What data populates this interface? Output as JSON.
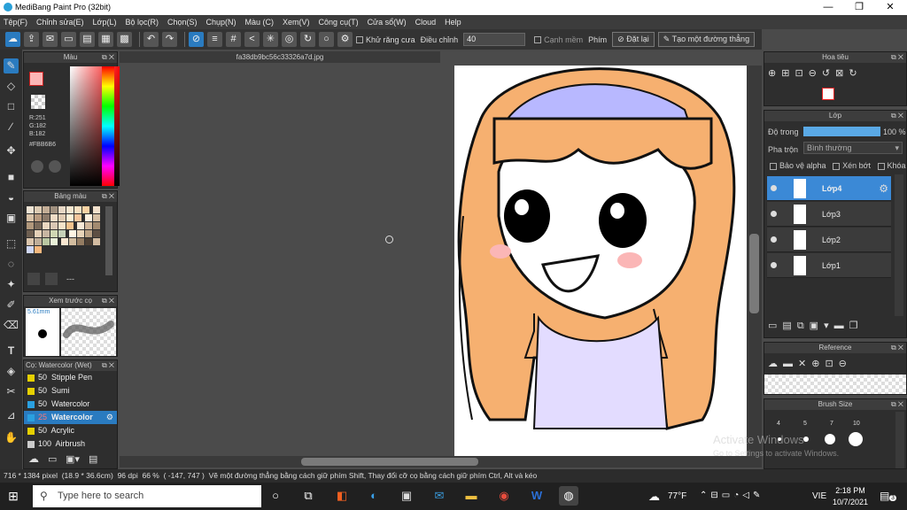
{
  "window": {
    "title": "MediBang Paint Pro (32bit)",
    "min": "—",
    "max": "❐",
    "close": "✕"
  },
  "menu": [
    "Tệp(F)",
    "Chỉnh sửa(E)",
    "Lớp(L)",
    "Bộ lọc(R)",
    "Chọn(S)",
    "Chụp(N)",
    "Màu (C)",
    "Xem(V)",
    "Công cụ(T)",
    "Cửa sổ(W)",
    "Cloud",
    "Help"
  ],
  "toolbar": {
    "antialias_label": "Khử răng cưa",
    "adjust_label": "Điều chỉnh",
    "adjust_value": "40",
    "edge_label": "Cạnh mềm",
    "key_label": "Phím",
    "reset_label": "Đặt lại",
    "create_line_label": "Tạo một đường thẳng"
  },
  "color_panel": {
    "title": "Màu",
    "r": "R:251",
    "g": "G:182",
    "b": "B:182",
    "hex": "#FBB6B6",
    "fg": "#fbb6b6"
  },
  "palette_panel": {
    "title": "Bảng màu",
    "placeholder": "---"
  },
  "brush_preview": {
    "title": "Xem trước cọ",
    "size": "5.61mm"
  },
  "brush_list": {
    "title": "Cọ: Watercolor (Wet)",
    "items": [
      {
        "size": "50",
        "name": "Stipple Pen"
      },
      {
        "size": "50",
        "name": "Sumi"
      },
      {
        "size": "50",
        "name": "Watercolor"
      },
      {
        "size": "25",
        "name": "Watercolor"
      },
      {
        "size": "50",
        "name": "Acrylic"
      },
      {
        "size": "100",
        "name": "Airbrush"
      }
    ]
  },
  "canvas": {
    "filename": "fa38db9bc56c33326a7d.jpg"
  },
  "navigator": {
    "title": "Hoa tiêu"
  },
  "layers_panel": {
    "title": "Lớp",
    "opacity_label": "Độ trong",
    "opacity_value": "100 %",
    "opacity": 1.0,
    "blend_label": "Pha trộn",
    "blend_value": "Bình thường",
    "protect_alpha": "Bảo vệ alpha",
    "clipping": "Xén bớt",
    "lock": "Khóa",
    "layers": [
      "Lớp4",
      "Lớp3",
      "Lớp2",
      "Lớp1"
    ]
  },
  "reference_panel": {
    "title": "Reference"
  },
  "brush_size_panel": {
    "title": "Brush Size",
    "sizes": [
      "4",
      "5",
      "7",
      "10"
    ]
  },
  "status": {
    "size": "716 * 1384 pixel",
    "physical": "(18.9 * 36.6cm)",
    "dpi": "96 dpi",
    "zoom": "66 %",
    "coords": "( -147, 747 )",
    "hint": "Vẽ một đường thẳng bằng cách giữ phím Shift, Thay đổi cỡ cọ bằng cách giữ phím Ctrl, Alt và kéo"
  },
  "watermark": {
    "line1": "Activate Windows",
    "line2": "Go to Settings to activate Windows."
  },
  "taskbar": {
    "search_placeholder": "Type here to search",
    "weather": "77°F",
    "lang": "VIE",
    "time": "2:18 PM",
    "date": "10/7/2021",
    "notifications": "3"
  }
}
